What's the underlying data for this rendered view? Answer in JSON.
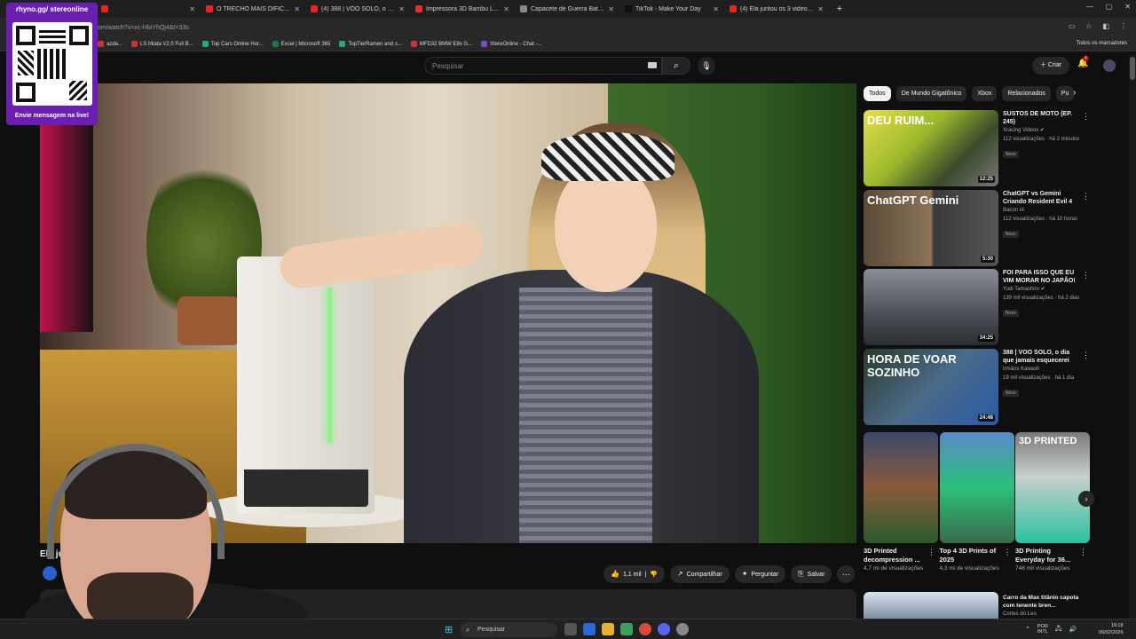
{
  "browser": {
    "tabs": [
      {
        "label": "",
        "color": "#e22"
      },
      {
        "label": "O TRECHO MAIS DIFÍCIL! Tras",
        "color": "#e22"
      },
      {
        "label": "(4) 388 | VOO SOLO, o dia que",
        "color": "#e22"
      },
      {
        "label": "Impressora 3D Bambu Lab P2S",
        "color": "#d33"
      },
      {
        "label": "Capacete de Guerra Battle Cat",
        "color": "#888"
      },
      {
        "label": "TikTok - Make Your Day",
        "color": "#111"
      },
      {
        "label": "(4) Ela juntou os 3 videogames",
        "color": "#e22"
      }
    ],
    "url": "om/watch?v=xc-HbiYhQj4&t=33s",
    "bookmarks": [
      {
        "label": "azda...",
        "color": "#c33"
      },
      {
        "label": "LS Miata V2.0 Full B...",
        "color": "#c33"
      },
      {
        "label": "Top Cars Online Hor...",
        "color": "#2a8"
      },
      {
        "label": "Excel | Microsoft 365",
        "color": "#1a7a40"
      },
      {
        "label": "TopTierRamen and s...",
        "color": "#2a8"
      },
      {
        "label": "MFD32 BMW E8x G...",
        "color": "#c33"
      },
      {
        "label": "StereOnline - Chat -...",
        "color": "#7a4ad0"
      }
    ],
    "all_bookmarks": "Todos os marcadores"
  },
  "youtube": {
    "search_placeholder": "Pesquisar",
    "create_label": "Criar",
    "notif_count": "4",
    "title_partial": "Ela ju",
    "actions": {
      "likes": "1,1 mil",
      "share": "Compartilhar",
      "ask": "Perguntar",
      "save": "Salvar"
    },
    "chips": [
      {
        "label": "Todos",
        "on": true
      },
      {
        "label": "De Mundo Gigatônico"
      },
      {
        "label": "Xbox"
      },
      {
        "label": "Relacionados"
      },
      {
        "label": "Pu"
      }
    ],
    "recs": [
      {
        "title": "SUSTOS DE MOTO (EP. 245)",
        "channel": "Xracing Videos ✔",
        "views": "112 visualizações · há 2 minutos",
        "badge": "Novo",
        "duration": "12:25",
        "overlay": "DEU RUIM...",
        "bg": "linear-gradient(135deg,#e8e04a,#9bb82c 40%,#3a4a2a 70%,#777)"
      },
      {
        "title": "ChatGPT vs Gemini Criando Resident Evil 4 d...",
        "channel": "Bacon IA",
        "views": "112 visualizações · há 10 horas",
        "badge": "Novo",
        "duration": "5:30",
        "overlay": "ChatGPT   Gemini",
        "bg": "linear-gradient(90deg,#5a4a38,#8a7358 50%,#3a3a3a 52%,#555)"
      },
      {
        "title": "FOI PARA ISSO QUE EU VIM MORAR NO JAPÃO!",
        "channel": "Yudi Tamashiro ✔",
        "views": "139 mil visualizações · há 2 dias",
        "badge": "Novo",
        "duration": "34:25",
        "overlay": "",
        "bg": "linear-gradient(180deg,#8a8f96,#4a4f56 60%,#2a2d31)"
      },
      {
        "title": "388 | VOO SOLO, o dia que jamais esquecerei",
        "channel": "Irmãos Kawash",
        "views": "19 mil visualizações · há 1 dia",
        "badge": "Novo",
        "duration": "24:48",
        "overlay": "HORA DE VOAR SOZINHO",
        "bg": "linear-gradient(135deg,#2a3a2a,#4a6a88 50%,#2a5aa8)"
      }
    ],
    "shorts": [
      {
        "title": "3D Printed decompression ...",
        "views": "4,7 mi de visualizações",
        "label": "",
        "bg": "linear-gradient(180deg,#3a4a6a,#8a5a3a 50%,#2a5a2a)"
      },
      {
        "title": "Top 4 3D Prints of 2025",
        "views": "4,3 mi de visualizações",
        "label": "",
        "bg": "linear-gradient(180deg,#5a8aca,#2ac07a 50%,#3a6a4a)"
      },
      {
        "title": "3D Printing Everyday for 36...",
        "views": "748 mil visualizações",
        "label": "3D PRINTED",
        "bg": "linear-gradient(180deg,#7a7a7a,#c8d0cc 40%,#2ac0a0)"
      }
    ],
    "last_rec": {
      "title": "Carro da Max titânio capota com tenente bren...",
      "channel": "Cortes do Leo"
    }
  },
  "overlay": {
    "qr_title": "rhyno.gg/ stereonline",
    "qr_caption": "Envie mensagem na live!"
  },
  "taskbar": {
    "search": "Pesquisar",
    "lang1": "POR",
    "lang2": "INTL",
    "time": "19:18",
    "date": "09/02/2026"
  }
}
